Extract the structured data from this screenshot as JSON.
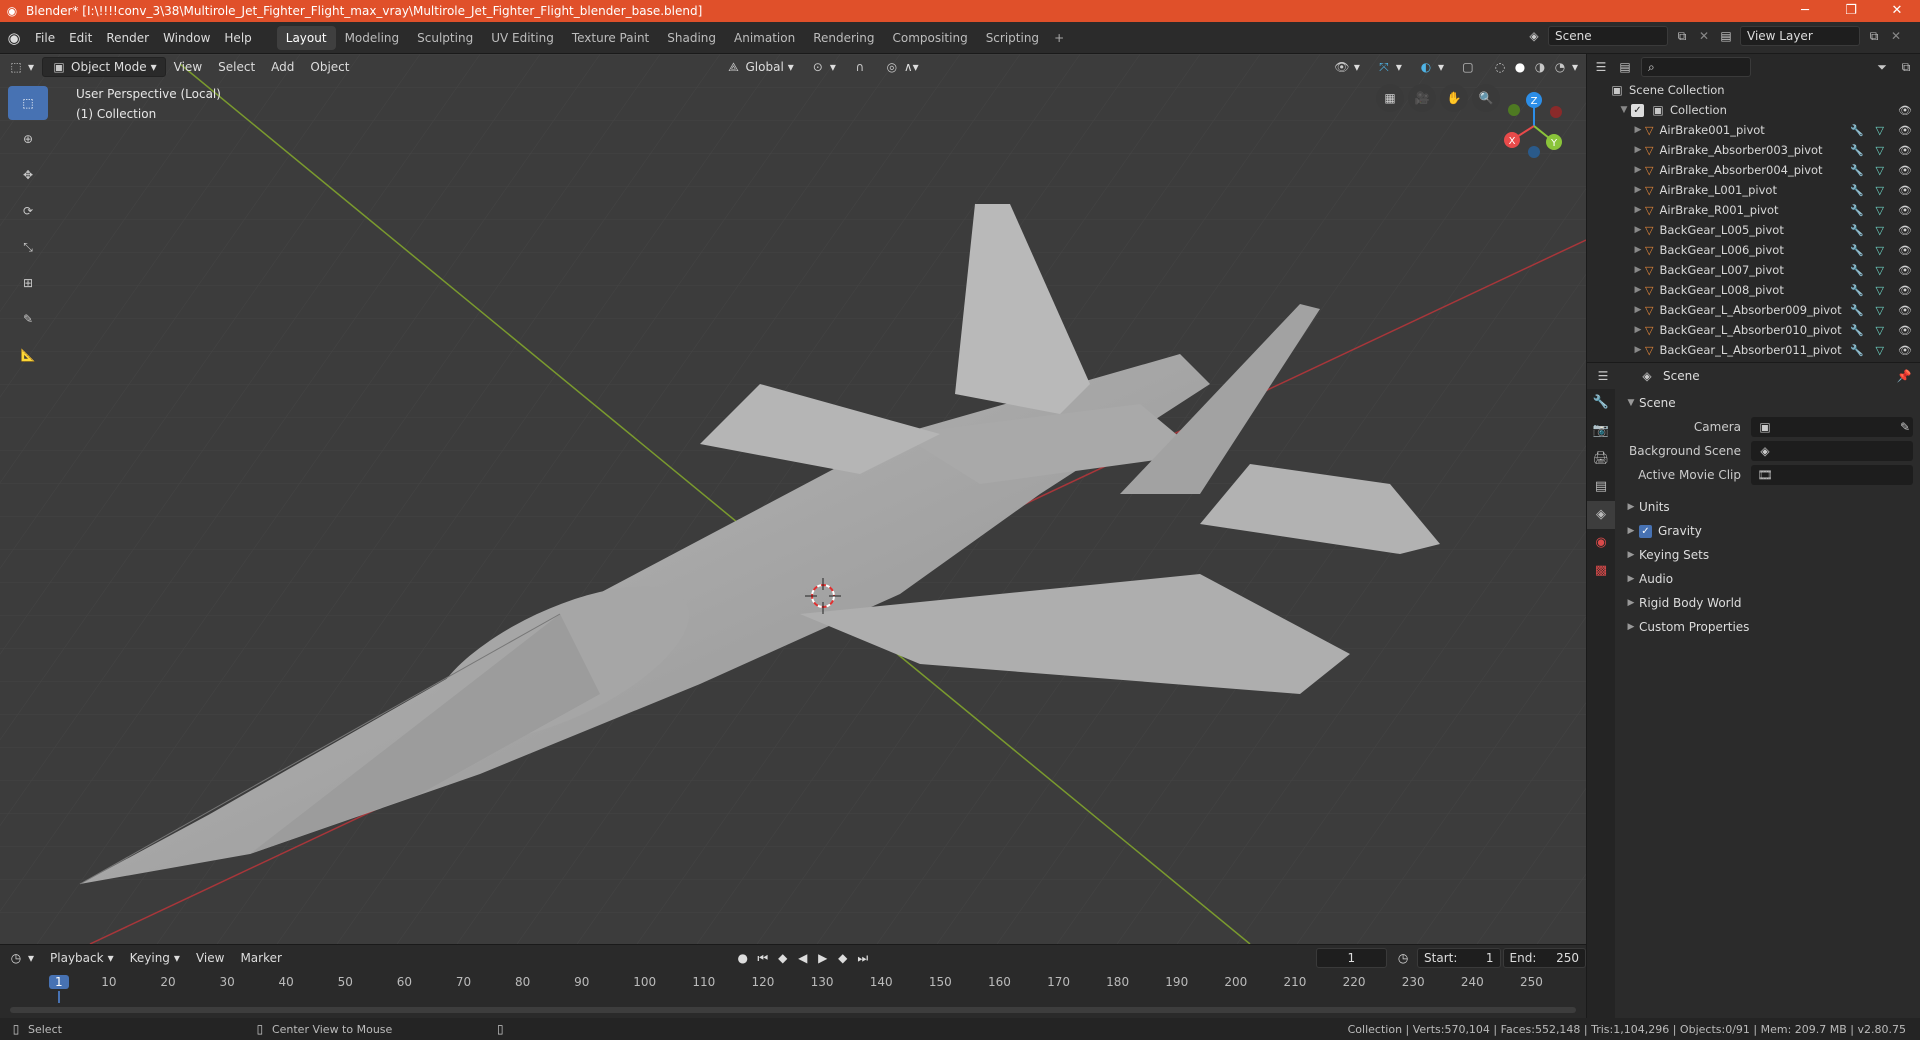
{
  "window": {
    "title": "Blender* [I:\\!!!!conv_3\\38\\Multirole_Jet_Fighter_Flight_max_vray\\Multirole_Jet_Fighter_Flight_blender_base.blend]",
    "minimize": "─",
    "maximize": "❐",
    "close": "✕"
  },
  "menu": [
    "File",
    "Edit",
    "Render",
    "Window",
    "Help"
  ],
  "workspaces": [
    "Layout",
    "Modeling",
    "Sculpting",
    "UV Editing",
    "Texture Paint",
    "Shading",
    "Animation",
    "Rendering",
    "Compositing",
    "Scripting"
  ],
  "active_workspace": "Layout",
  "scene_name": "Scene",
  "view_layer": "View Layer",
  "viewport": {
    "mode": "Object Mode",
    "menus": [
      "View",
      "Select",
      "Add",
      "Object"
    ],
    "transform_orientation": "Global",
    "info_line1": "User Perspective (Local)",
    "info_line2": "(1) Collection",
    "gizmo": {
      "x": "X",
      "y": "Y",
      "z": "Z"
    }
  },
  "timeline": {
    "menus": [
      "Playback",
      "Keying",
      "View",
      "Marker"
    ],
    "current_frame": "1",
    "start_label": "Start:",
    "start": "1",
    "end_label": "End:",
    "end": "250",
    "ticks": [
      "1",
      "10",
      "20",
      "30",
      "40",
      "50",
      "60",
      "70",
      "80",
      "90",
      "100",
      "110",
      "120",
      "130",
      "140",
      "150",
      "160",
      "170",
      "180",
      "190",
      "200",
      "210",
      "220",
      "230",
      "240",
      "250"
    ]
  },
  "status": {
    "left": "Select",
    "middle": "Center View to Mouse",
    "right": "Collection | Verts:570,104 | Faces:552,148 | Tris:1,104,296 | Objects:0/91 | Mem: 209.7 MB | v2.80.75"
  },
  "outliner": {
    "root": "Scene Collection",
    "collection": "Collection",
    "items": [
      "AirBrake001_pivot",
      "AirBrake_Absorber003_pivot",
      "AirBrake_Absorber004_pivot",
      "AirBrake_L001_pivot",
      "AirBrake_R001_pivot",
      "BackGear_L005_pivot",
      "BackGear_L006_pivot",
      "BackGear_L007_pivot",
      "BackGear_L008_pivot",
      "BackGear_L_Absorber009_pivot",
      "BackGear_L_Absorber010_pivot",
      "BackGear_L_Absorber011_pivot"
    ]
  },
  "properties": {
    "context": "Scene",
    "panel": "Scene",
    "camera_label": "Camera",
    "background_label": "Background Scene",
    "movieclip_label": "Active Movie Clip",
    "sections": [
      "Units",
      "Gravity",
      "Keying Sets",
      "Audio",
      "Rigid Body World",
      "Custom Properties"
    ]
  }
}
